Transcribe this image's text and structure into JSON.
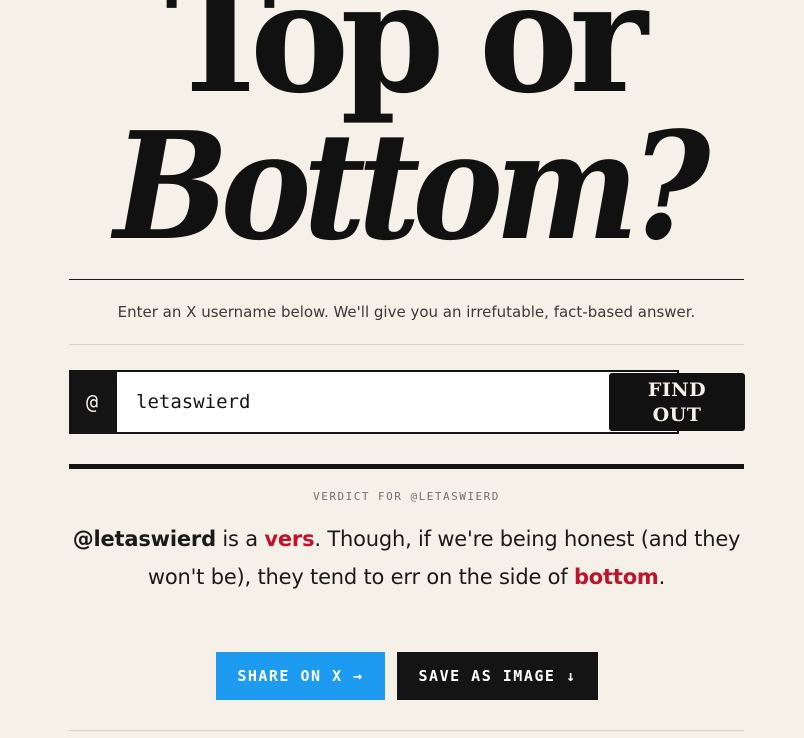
{
  "header": {
    "title_line1": "Top or",
    "title_line2": "Bottom?"
  },
  "subtitle": "Enter an X username below. We'll give you an irrefutable, fact-based answer.",
  "search": {
    "prefix": "@",
    "value": "letaswierd",
    "button_label": "FIND\nOUT"
  },
  "result": {
    "label": "VERDICT FOR @LETASWIERD",
    "handle": "@letaswierd",
    "text_1": " is a ",
    "primary_verdict": "vers",
    "text_2": ". Though, if we're being honest (and they won't be), they tend to err on the side of ",
    "secondary_verdict": "bottom",
    "text_3": "."
  },
  "actions": {
    "share_label": "SHARE ON X →",
    "save_label": "SAVE AS IMAGE ↓"
  },
  "colors": {
    "background": "#f5f0e8",
    "ink": "#141414",
    "accent_red": "#c0122a",
    "share_blue": "#1d9bf0"
  }
}
